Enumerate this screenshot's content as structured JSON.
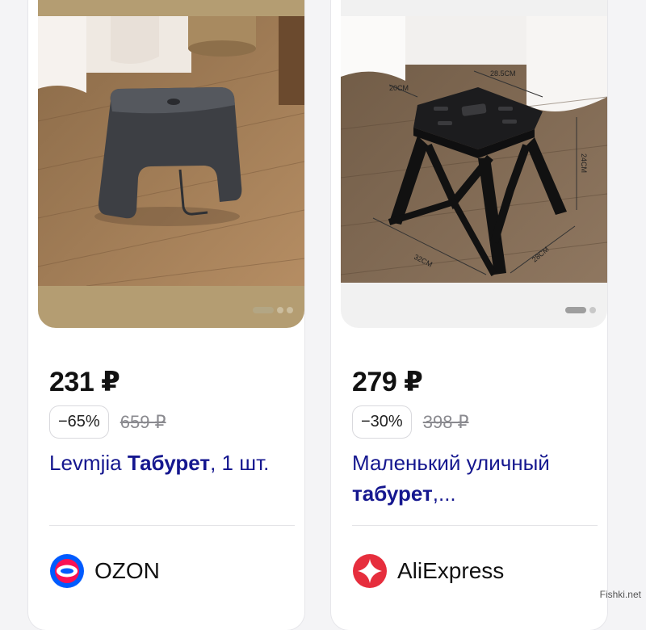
{
  "products": [
    {
      "price": "231 ₽",
      "discount": "−65%",
      "old_price": "659 ₽",
      "title_prefix": "Levmjia ",
      "title_bold": "Табурет",
      "title_suffix": ", 1 шт.",
      "store": "OZON",
      "store_icon": "ozon-logo-icon",
      "image": "gray-plastic-stool-photo",
      "carousel_count": 3,
      "carousel_active": 0
    },
    {
      "price": "279 ₽",
      "discount": "−30%",
      "old_price": "398 ₽",
      "title_prefix": "Маленький уличный ",
      "title_bold": "табурет",
      "title_suffix": ",...",
      "store": "AliExpress",
      "store_icon": "aliexpress-logo-icon",
      "image": "black-folding-stool-photo",
      "image_labels": [
        "20CM",
        "28.5CM",
        "24CM",
        "32CM",
        "28CM"
      ],
      "carousel_count": 2,
      "carousel_active": 0
    }
  ],
  "watermark": "Fishki.net",
  "colors": {
    "title_text": "#15178f",
    "ozon_blue": "#005bff",
    "ozon_red": "#f91155",
    "aliexpress_red": "#e62e3d"
  }
}
